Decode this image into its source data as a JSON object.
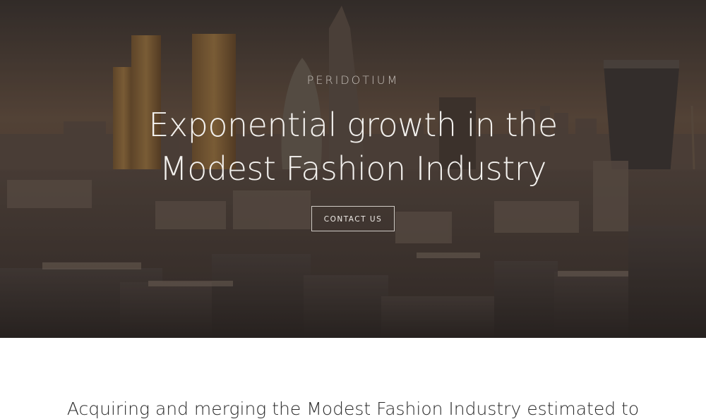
{
  "hero": {
    "brand": "PERIDOTIUM",
    "headline": "Exponential growth in the Modest Fashion Industry",
    "cta_label": "CONTACT US",
    "background_image": "city-skyline-photo",
    "overlay_color": "#14100e"
  },
  "intro": {
    "text": "Acquiring and merging the Modest Fashion Industry estimated to"
  },
  "colors": {
    "headline": "#f3f1ee",
    "body_text": "#2b2b2b",
    "page_background": "#ffffff"
  }
}
